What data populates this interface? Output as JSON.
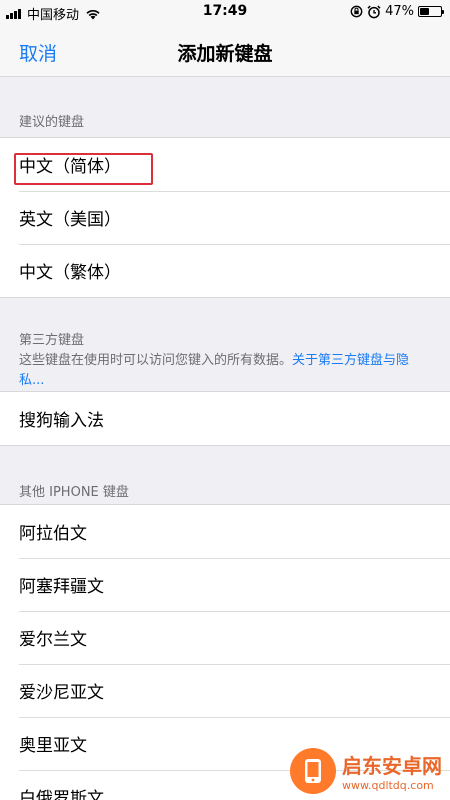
{
  "status_bar": {
    "carrier": "中国移动",
    "time": "17:49",
    "battery_percent": "47%",
    "battery_level": 0.47
  },
  "nav": {
    "cancel_label": "取消",
    "title": "添加新键盘"
  },
  "suggested": {
    "header": "建议的键盘",
    "items": [
      "中文（简体）",
      "英文（美国）",
      "中文（繁体）"
    ]
  },
  "third_party": {
    "header_line": "第三方键盘",
    "description": "这些键盘在使用时可以访问您键入的所有数据。",
    "link": "关于第三方键盘与隐私...",
    "items": [
      "搜狗输入法"
    ]
  },
  "other_iphone": {
    "header": "其他 IPHONE 键盘",
    "items": [
      "阿拉伯文",
      "阿塞拜疆文",
      "爱尔兰文",
      "爱沙尼亚文",
      "奥里亚文",
      "白俄罗斯文"
    ]
  },
  "watermark": {
    "title": "启东安卓网",
    "url": "www.qdltdq.com"
  },
  "colors": {
    "accent": "#1a7cf3",
    "highlight": "#d9303a",
    "watermark": "#e9672a"
  }
}
